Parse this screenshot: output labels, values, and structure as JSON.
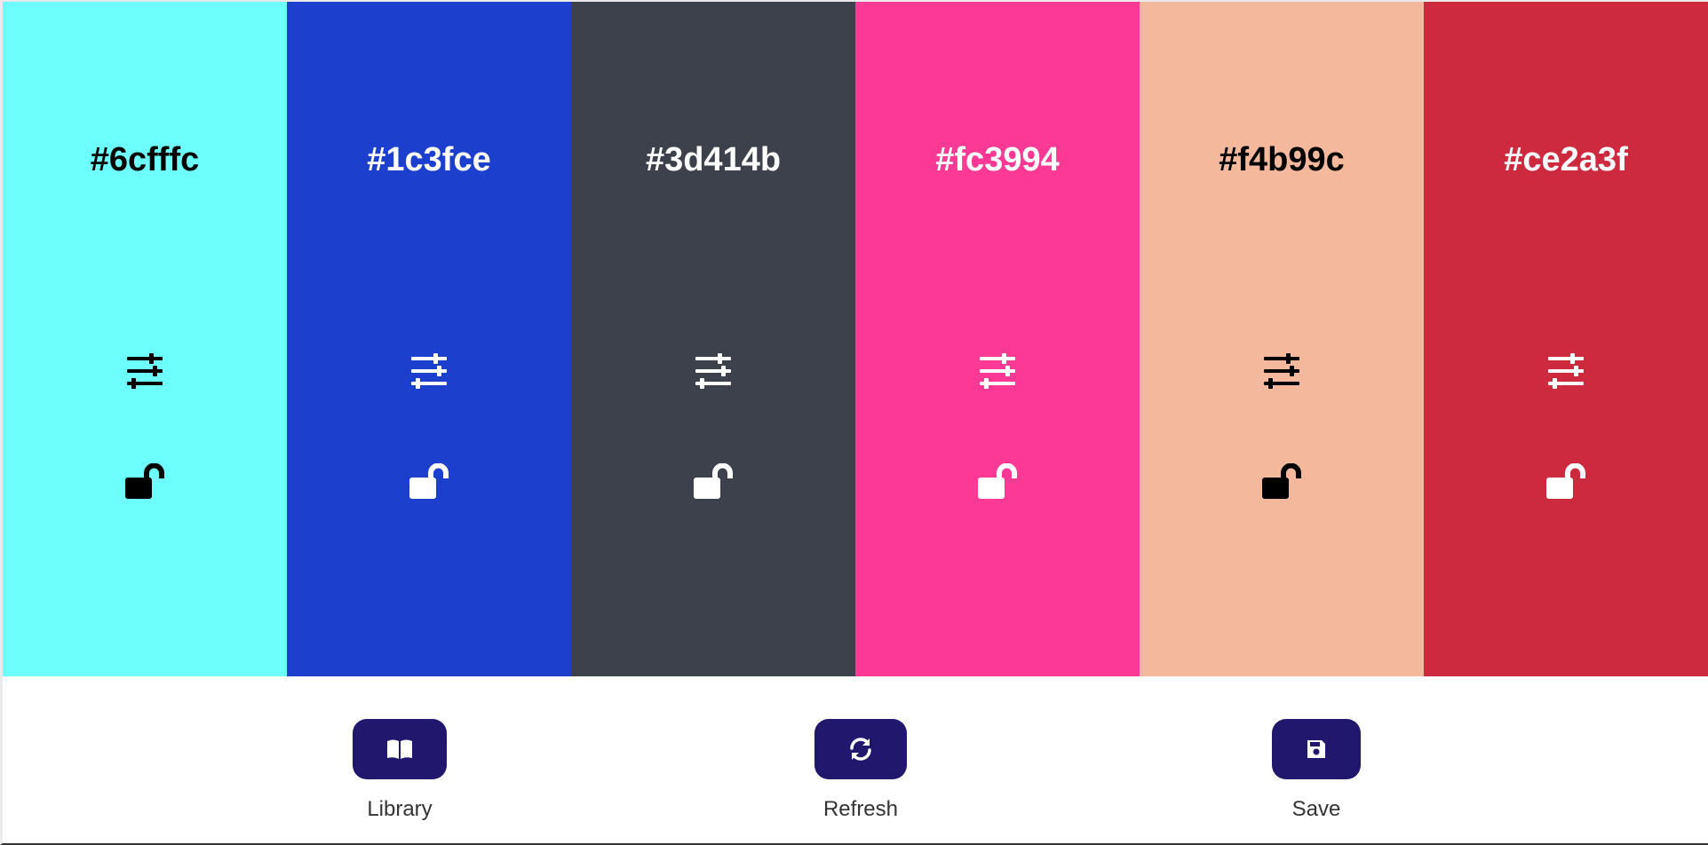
{
  "palette": [
    {
      "hex": "#6cfffc",
      "text_color": "#000000"
    },
    {
      "hex": "#1c3fce",
      "text_color": "#ffffff"
    },
    {
      "hex": "#3d414b",
      "text_color": "#ffffff"
    },
    {
      "hex": "#fc3994",
      "text_color": "#ffffff"
    },
    {
      "hex": "#f4b99c",
      "text_color": "#000000"
    },
    {
      "hex": "#ce2a3f",
      "text_color": "#ffffff"
    }
  ],
  "icons": {
    "adjust": "sliders-icon",
    "lock": "unlock-icon",
    "library": "book-open-icon",
    "refresh": "sync-icon",
    "save": "floppy-disk-icon"
  },
  "toolbar": {
    "library_label": "Library",
    "refresh_label": "Refresh",
    "save_label": "Save",
    "button_color": "#21186d"
  }
}
